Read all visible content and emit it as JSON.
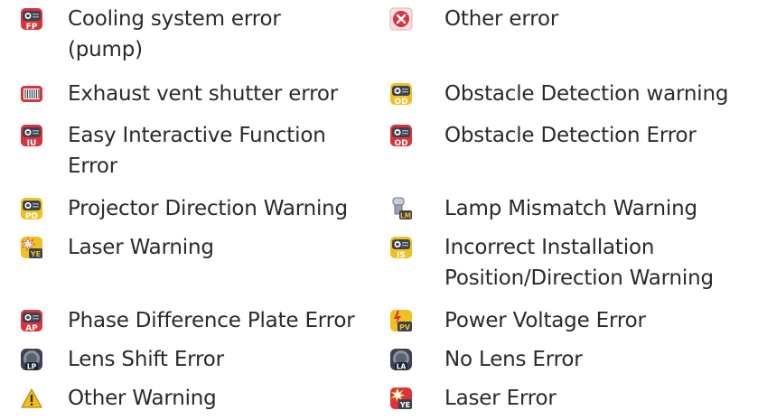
{
  "colors": {
    "error_red": "#d9343b",
    "warning_yellow": "#f0c020",
    "icon_dark": "#3c4250",
    "text": "#2a2a2a"
  },
  "items": [
    {
      "icon": "cooling-pump-error-icon",
      "code": "FP",
      "lines": [
        "Cooling system error",
        "(pump)"
      ]
    },
    {
      "icon": "other-error-icon",
      "code": "",
      "lines": [
        "Other error"
      ]
    },
    {
      "icon": "exhaust-shutter-error-icon",
      "code": "",
      "lines": [
        "Exhaust vent shutter error"
      ]
    },
    {
      "icon": "obstacle-detection-warning-icon",
      "code": "OD",
      "lines": [
        "Obstacle Detection warning"
      ]
    },
    {
      "icon": "easy-interactive-error-icon",
      "code": "IU",
      "lines": [
        "Easy Interactive Function",
        "Error"
      ]
    },
    {
      "icon": "obstacle-detection-error-icon",
      "code": "OD",
      "lines": [
        "Obstacle Detection Error"
      ]
    },
    {
      "icon": "projector-direction-warning-icon",
      "code": "PD",
      "lines": [
        "Projector Direction Warning"
      ]
    },
    {
      "icon": "lamp-mismatch-warning-icon",
      "code": "LM",
      "lines": [
        "Lamp Mismatch Warning"
      ]
    },
    {
      "icon": "laser-warning-icon",
      "code": "YE",
      "lines": [
        "Laser Warning"
      ]
    },
    {
      "icon": "installation-position-warning-icon",
      "code": "IS",
      "lines": [
        "Incorrect Installation",
        "Position/Direction Warning"
      ]
    },
    {
      "icon": "phase-plate-error-icon",
      "code": "AP",
      "lines": [
        "Phase Difference Plate Error"
      ]
    },
    {
      "icon": "power-voltage-error-icon",
      "code": "PV",
      "lines": [
        "Power Voltage Error"
      ]
    },
    {
      "icon": "lens-shift-error-icon",
      "code": "LP",
      "lines": [
        "Lens Shift Error"
      ]
    },
    {
      "icon": "no-lens-error-icon",
      "code": "LA",
      "lines": [
        "No Lens Error"
      ]
    },
    {
      "icon": "other-warning-icon",
      "code": "",
      "lines": [
        "Other Warning"
      ]
    },
    {
      "icon": "laser-error-icon",
      "code": "YE",
      "lines": [
        "Laser Error"
      ]
    }
  ]
}
